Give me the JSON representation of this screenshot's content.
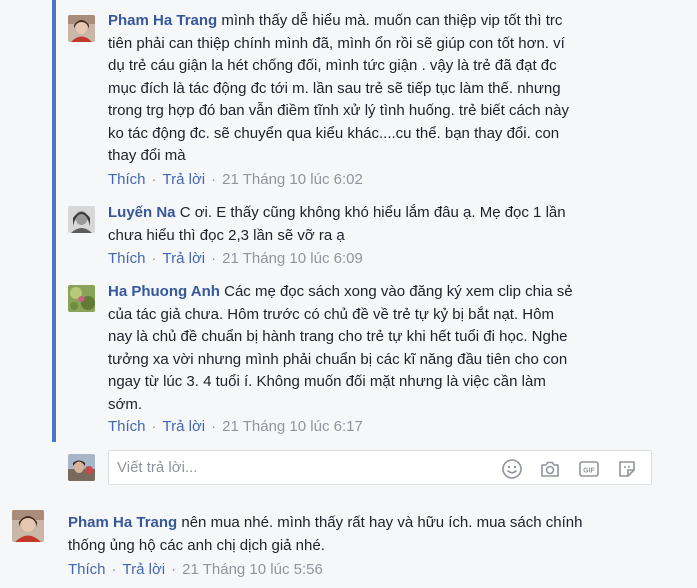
{
  "comments": [
    {
      "author": "Pham Ha Trang",
      "lines": [
        "mình thấy dễ hiểu mà. muốn can thiệp vip tốt thì trc",
        "tiên phải can thiệp chính mình đã, mình ổn rồi sẽ giúp con tốt hơn. ví",
        "dụ trẻ cáu giận la hét chống đối, mình tức giận . vậy là trẻ đã đạt đc",
        "mục đích là tác động đc tới m. lần sau trẻ sẽ tiếp tục làm thế. nhưng",
        "trong trg hợp đó ban vẫn điềm tĩnh xử lý tình huống. trẻ biết cách này",
        "ko tác động đc. sẽ chuyển qua kiểu khác....cu thể. bạn thay đổi. con",
        "thay đổi mà"
      ],
      "like": "Thích",
      "reply": "Trả lời",
      "time": "21 Tháng 10 lúc 6:02"
    },
    {
      "author": "Luyến Na",
      "lines": [
        "C ơi. E thấy cũng không khó hiểu lắm đâu ạ. Mẹ đọc 1 lần",
        "chưa hiểu thì đọc 2,3 lần sẽ vỡ ra ạ"
      ],
      "like": "Thích",
      "reply": "Trả lời",
      "time": "21 Tháng 10 lúc 6:09"
    },
    {
      "author": "Ha Phuong Anh",
      "lines": [
        "Các mẹ đọc sách xong vào đăng ký xem clip chia sẻ",
        "của tác giả chưa. Hôm trước có chủ đề về trẻ tự kỷ bị bắt nạt. Hôm",
        "nay là chủ đề chuẩn bị hành trang cho trẻ tự khi hết tuổi đi học. Nghe",
        "tưởng xa vời nhưng mình phải chuẩn bị các kĩ năng đầu tiên cho con",
        "ngay từ lúc 3. 4 tuổi í. Không muốn đối mặt nhưng là việc cần làm",
        "sớm."
      ],
      "like": "Thích",
      "reply": "Trả lời",
      "time": "21 Tháng 10 lúc 6:17"
    }
  ],
  "reply_box": {
    "placeholder": "Viết trả lời...",
    "icons": [
      "emoji-icon",
      "camera-icon",
      "gif-icon",
      "sticker-icon"
    ]
  },
  "top_comment": {
    "author": "Pham Ha Trang",
    "lines": [
      "nên mua nhé. mình thấy rất hay và hữu ích. mua sách chính",
      "thống ủng hộ các anh chị dịch giả nhé."
    ],
    "like": "Thích",
    "reply": "Trả lời",
    "time": "21 Tháng 10 lúc 5:56"
  },
  "colors": {
    "link": "#4267b2",
    "author": "#365899",
    "meta": "#90949c",
    "thread_bar": "#4a76c9",
    "background": "#f6f7f9"
  }
}
